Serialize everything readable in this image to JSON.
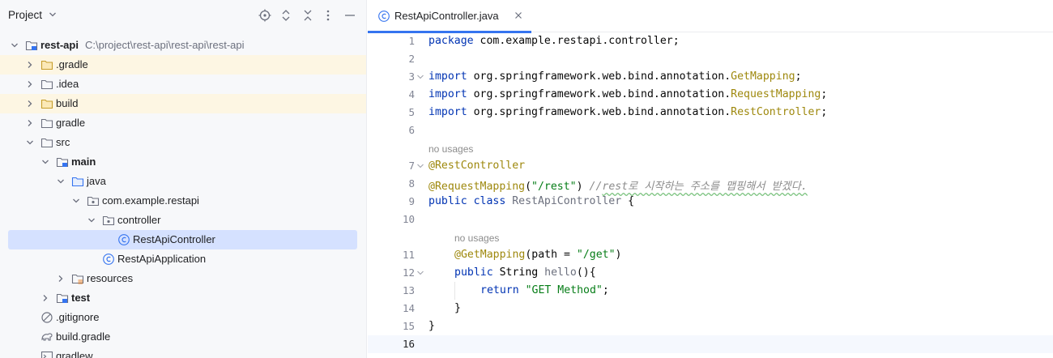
{
  "project_panel": {
    "title": "Project"
  },
  "tree": {
    "root_label": "rest-api",
    "root_path": "C:\\project\\rest-api\\rest-api\\rest-api",
    "items": [
      {
        "label": ".gradle"
      },
      {
        "label": ".idea"
      },
      {
        "label": "build"
      },
      {
        "label": "gradle"
      },
      {
        "label": "src"
      },
      {
        "label": "main"
      },
      {
        "label": "java"
      },
      {
        "label": "com.example.restapi"
      },
      {
        "label": "controller"
      },
      {
        "label": "RestApiController"
      },
      {
        "label": "RestApiApplication"
      },
      {
        "label": "resources"
      },
      {
        "label": "test"
      },
      {
        "label": ".gitignore"
      },
      {
        "label": "build.gradle"
      },
      {
        "label": "gradlew"
      }
    ]
  },
  "editor": {
    "tab_label": "RestApiController.java",
    "line_numbers": [
      "1",
      "2",
      "3",
      "4",
      "5",
      "6",
      "7",
      "8",
      "9",
      "10",
      "11",
      "12",
      "13",
      "14",
      "15",
      "16"
    ],
    "inlay_no_usages": "no usages",
    "code": {
      "l1_kw": "package",
      "l1_rest": " com.example.restapi.controller;",
      "import_kw": "import",
      "l3_pkg": " org.springframework.web.bind.annotation.",
      "l3_cls": "GetMapping",
      "l4_cls": "RequestMapping",
      "l5_cls": "RestController",
      "semicolon": ";",
      "l7_ann": "@RestController",
      "l8_ann": "@RequestMapping",
      "l8_open": "(",
      "l8_str": "\"/rest\"",
      "l8_close": ") ",
      "l8_cmt_a": "//",
      "l8_cmt_b": "rest로 시작하는 주소를 맵핑해서 받겠다.",
      "l9_kw": "public class ",
      "l9_cls": "RestApiController",
      "l9_rest": " {",
      "l11_ann": "@GetMapping",
      "l11_mid": "(path = ",
      "l11_str": "\"/get\"",
      "l11_close": ")",
      "l12_kw": "public ",
      "l12_type": "String ",
      "l12_method": "hello",
      "l12_rest": "(){",
      "l13_kw": "return ",
      "l13_str": "\"GET Method\"",
      "l13_end": ";",
      "l14": "}",
      "l15": "}"
    }
  }
}
